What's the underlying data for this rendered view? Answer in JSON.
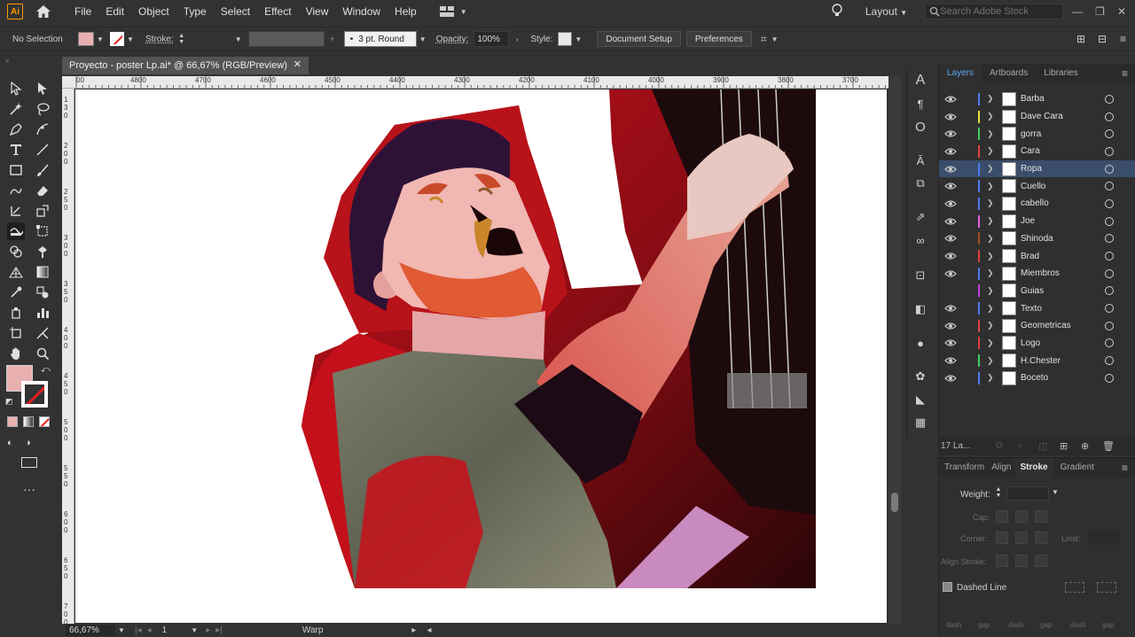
{
  "menu": [
    "File",
    "Edit",
    "Object",
    "Type",
    "Select",
    "Effect",
    "View",
    "Window",
    "Help"
  ],
  "app_logo": "Ai",
  "workspace": "Layout",
  "stock_search_placeholder": "Search Adobe Stock",
  "controlbar": {
    "selection": "No Selection",
    "stroke_label": "Stroke:",
    "brush": "3 pt. Round",
    "opacity_label": "Opacity:",
    "opacity": "100%",
    "style_label": "Style:",
    "document_setup": "Document Setup",
    "preferences": "Preferences",
    "fill_color": "#e8b1b0"
  },
  "doc_tab": {
    "title": "Proyecto - poster Lp.ai* @ 66,67% (RGB/Preview)"
  },
  "ruler_h": [
    "00",
    "4800",
    "4700",
    "4600",
    "4500",
    "4400",
    "4300",
    "4200",
    "4100",
    "4000",
    "3900",
    "3800",
    "3700"
  ],
  "ruler_v": [
    "1 3 0",
    "2 0 0",
    "2 5 0",
    "3 0 0",
    "3 5 0",
    "4 0 0",
    "4 5 0",
    "5 0 0",
    "5 5 0",
    "6 0 0",
    "6 5 0",
    "7 0 0"
  ],
  "status": {
    "zoom": "66,67%",
    "artboard": "1",
    "tool": "Warp"
  },
  "layers_panel": {
    "tabs": [
      "Layers",
      "Artboards",
      "Libraries"
    ],
    "layers": [
      {
        "name": "Barba",
        "color": "#4f7cf0",
        "visible": true
      },
      {
        "name": "Dave Cara",
        "color": "#e8e040",
        "visible": true
      },
      {
        "name": "gorra",
        "color": "#40d060",
        "visible": true
      },
      {
        "name": "Cara",
        "color": "#e04040",
        "visible": true
      },
      {
        "name": "Ropa",
        "color": "#4f7cf0",
        "visible": true,
        "selected": true
      },
      {
        "name": "Cuello",
        "color": "#4f7cf0",
        "visible": true
      },
      {
        "name": "cabello",
        "color": "#4f7cf0",
        "visible": true
      },
      {
        "name": "Joe",
        "color": "#e060e0",
        "visible": true
      },
      {
        "name": "Shinoda",
        "color": "#a05020",
        "visible": true
      },
      {
        "name": "Brad",
        "color": "#e04040",
        "visible": true
      },
      {
        "name": "Miembros",
        "color": "#4f7cf0",
        "visible": true
      },
      {
        "name": "Guias",
        "color": "#c040e0",
        "visible": false
      },
      {
        "name": "Texto",
        "color": "#4f7cf0",
        "visible": true
      },
      {
        "name": "Geometricas",
        "color": "#e04040",
        "visible": true
      },
      {
        "name": "Logo",
        "color": "#e04040",
        "visible": true
      },
      {
        "name": "H.Chester",
        "color": "#40d060",
        "visible": true
      },
      {
        "name": "Boceto",
        "color": "#4f7cf0",
        "visible": true
      }
    ],
    "count": "17 La..."
  },
  "stroke_panel": {
    "tabs": [
      "Transform",
      "Align",
      "Stroke",
      "Gradient"
    ],
    "weight_label": "Weight:",
    "cap_label": "Cap:",
    "corner_label": "Corner:",
    "limit_label": "Limit:",
    "align_label": "Align Stroke:",
    "dashed_label": "Dashed Line",
    "dash_labels": [
      "dash",
      "gap",
      "dash",
      "gap",
      "dash",
      "gap"
    ]
  }
}
